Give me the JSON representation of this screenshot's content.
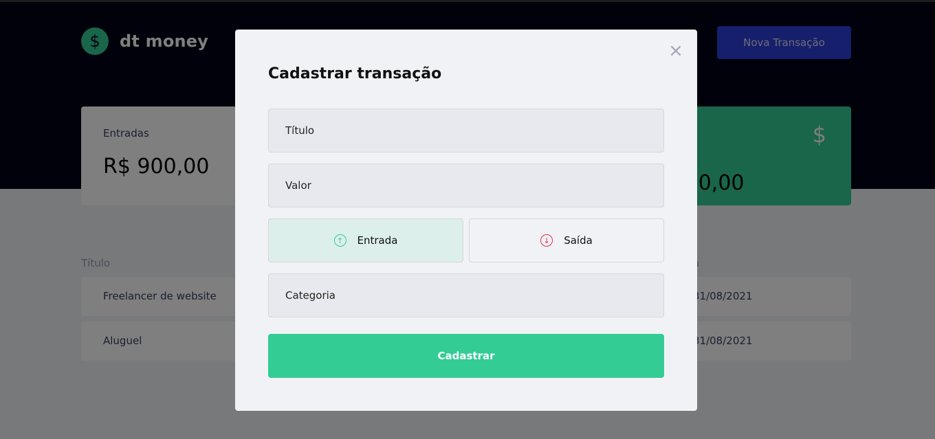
{
  "header": {
    "logo_icon": "$",
    "app_name": "dt money",
    "new_transaction_label": "Nova Transação"
  },
  "summary": {
    "income_label": "Entradas",
    "income_value": "R$ 900,00",
    "total_icon": "dollar-icon",
    "total_value_partial": ")0,00"
  },
  "table": {
    "headers": [
      "Título",
      "a"
    ],
    "rows": [
      {
        "title": "Freelancer de website",
        "date_partial": "31/08/2021"
      },
      {
        "title": "Aluguel",
        "date_partial": "31/08/2021"
      }
    ]
  },
  "modal": {
    "title": "Cadastrar transação",
    "close_icon": "×",
    "title_placeholder": "Título",
    "value_placeholder": "Valor",
    "income_type_label": "Entrada",
    "outcome_type_label": "Saída",
    "category_placeholder": "Categoria",
    "submit_label": "Cadastrar"
  },
  "colors": {
    "header_bg": "#010215",
    "accent_green": "#33cc95",
    "accent_blue": "#2c3fd6",
    "accent_red": "#e52e4d"
  }
}
